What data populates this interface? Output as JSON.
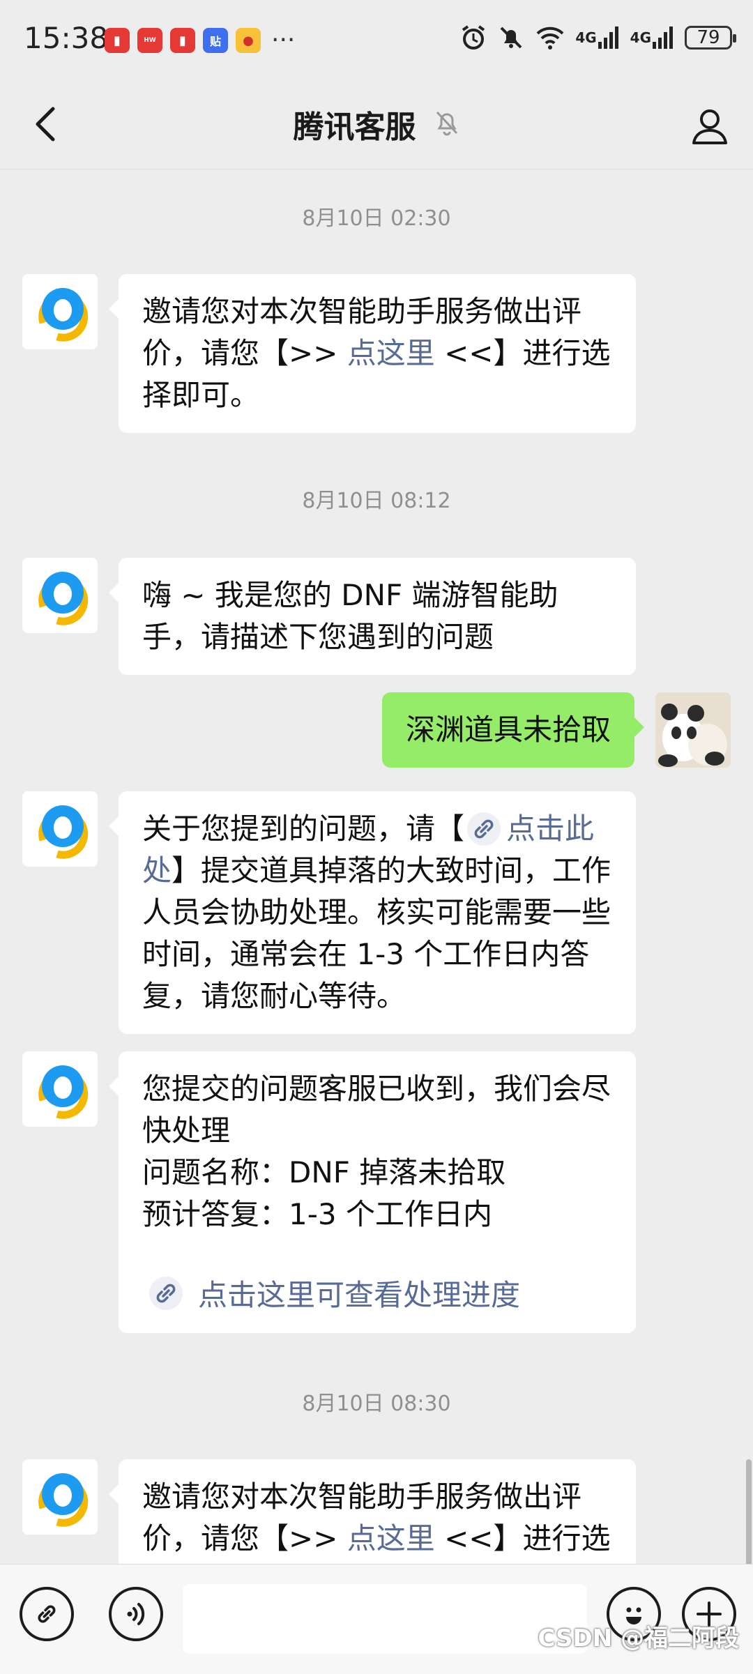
{
  "status_bar": {
    "time": "15:38",
    "battery": "79",
    "net_1": "4G",
    "net_2": "4G",
    "app_icons": [
      "redbook-app-icon",
      "huawei-app-icon",
      "redbook-app-icon",
      "tieba-app-icon",
      "weibo-app-icon"
    ],
    "more": "···"
  },
  "header": {
    "title": "腾讯客服"
  },
  "messages": [
    {
      "type": "time",
      "text": "8月10日 02:30"
    },
    {
      "type": "received",
      "text_before": "邀请您对本次智能助手服务做出评价，请您【>> ",
      "link": "点这里",
      "text_after": " <<】进行选择即可。"
    },
    {
      "type": "time",
      "text": "8月10日 08:12"
    },
    {
      "type": "received",
      "text": "嗨 ~ 我是您的 DNF 端游智能助手，请描述下您遇到的问题"
    },
    {
      "type": "sent",
      "text": "深渊道具未拾取"
    },
    {
      "type": "received",
      "text_before": "关于您提到的问题，请【",
      "link": "点击此处",
      "text_after": "】提交道具掉落的大致时间，工作人员会协助处理。核实可能需要一些时间，通常会在 1-3 个工作日内答复，请您耐心等待。"
    },
    {
      "type": "received",
      "line1": "您提交的问题客服已收到，我们会尽快处理",
      "line2": "问题名称：DNF 掉落未拾取",
      "line3": "预计答复：1-3 个工作日内",
      "link": "点击这里可查看处理进度"
    },
    {
      "type": "time",
      "text": "8月10日 08:30"
    },
    {
      "type": "received",
      "text_before": "邀请您对本次智能助手服务做出评价，请您【>> ",
      "link": "点这里",
      "text_after": " <<】进行选择即可。"
    }
  ],
  "watermark": "CSDN @福二阿段",
  "input": {
    "value": "",
    "placeholder": ""
  },
  "colors": {
    "background": "#ededed",
    "sent_bubble": "#95ec69",
    "link": "#576b95",
    "avatar_blue": "#1d9bf0",
    "avatar_yellow": "#f5b800"
  }
}
